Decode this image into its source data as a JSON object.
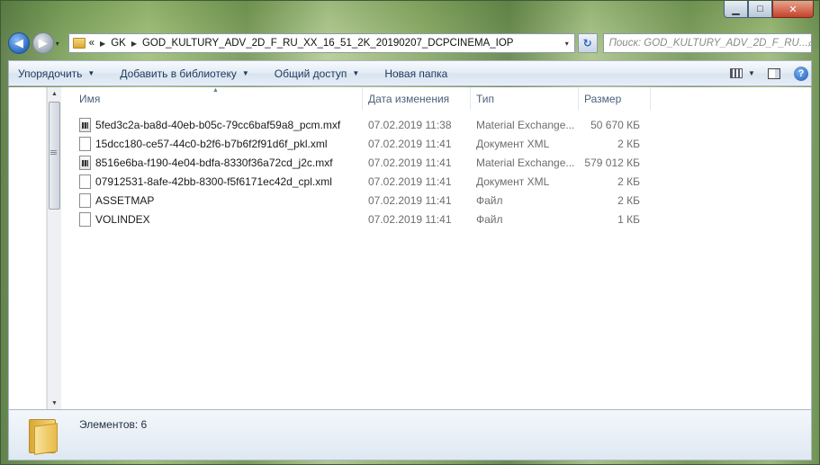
{
  "window": {
    "caption_buttons": {
      "minimize": "▁",
      "maximize": "□",
      "close": "✕"
    }
  },
  "nav": {
    "back_glyph": "◀",
    "forward_glyph": "▶",
    "history_glyph": "▾",
    "address_prefix": "«",
    "breadcrumb": [
      "GK",
      "GOD_KULTURY_ADV_2D_F_RU_XX_16_51_2K_20190207_DCPCINEMA_IOP"
    ],
    "breadcrumb_sep": "▶",
    "dropdown_glyph": "▾",
    "refresh_glyph": "↻",
    "search_placeholder": "Поиск: GOD_KULTURY_ADV_2D_F_RU...",
    "search_glyph": "⌕"
  },
  "toolbar": {
    "items": [
      "Упорядочить",
      "Добавить в библиотеку",
      "Общий доступ",
      "Новая папка"
    ],
    "dropdown_glyph": "▼",
    "help_glyph": "?"
  },
  "columns": {
    "name": "Имя",
    "date": "Дата изменения",
    "type": "Тип",
    "size": "Размер",
    "sort_glyph": "▲"
  },
  "files": [
    {
      "name": "5fed3c2a-ba8d-40eb-b05c-79cc6baf59a8_pcm.mxf",
      "date": "07.02.2019 11:38",
      "type": "Material Exchange...",
      "size": "50 670 КБ",
      "icon": "media-file-icon"
    },
    {
      "name": "15dcc180-ce57-44c0-b2f6-b7b6f2f91d6f_pkl.xml",
      "date": "07.02.2019 11:41",
      "type": "Документ XML",
      "size": "2 КБ",
      "icon": "document-icon"
    },
    {
      "name": "8516e6ba-f190-4e04-bdfa-8330f36a72cd_j2c.mxf",
      "date": "07.02.2019 11:41",
      "type": "Material Exchange...",
      "size": "579 012 КБ",
      "icon": "media-file-icon"
    },
    {
      "name": "07912531-8afe-42bb-8300-f5f6171ec42d_cpl.xml",
      "date": "07.02.2019 11:41",
      "type": "Документ XML",
      "size": "2 КБ",
      "icon": "document-icon"
    },
    {
      "name": "ASSETMAP",
      "date": "07.02.2019 11:41",
      "type": "Файл",
      "size": "2 КБ",
      "icon": "document-icon"
    },
    {
      "name": "VOLINDEX",
      "date": "07.02.2019 11:41",
      "type": "Файл",
      "size": "1 КБ",
      "icon": "document-icon"
    }
  ],
  "scrollbar": {
    "up_glyph": "▲",
    "down_glyph": "▼"
  },
  "details": {
    "count_text": "Элементов: 6"
  }
}
